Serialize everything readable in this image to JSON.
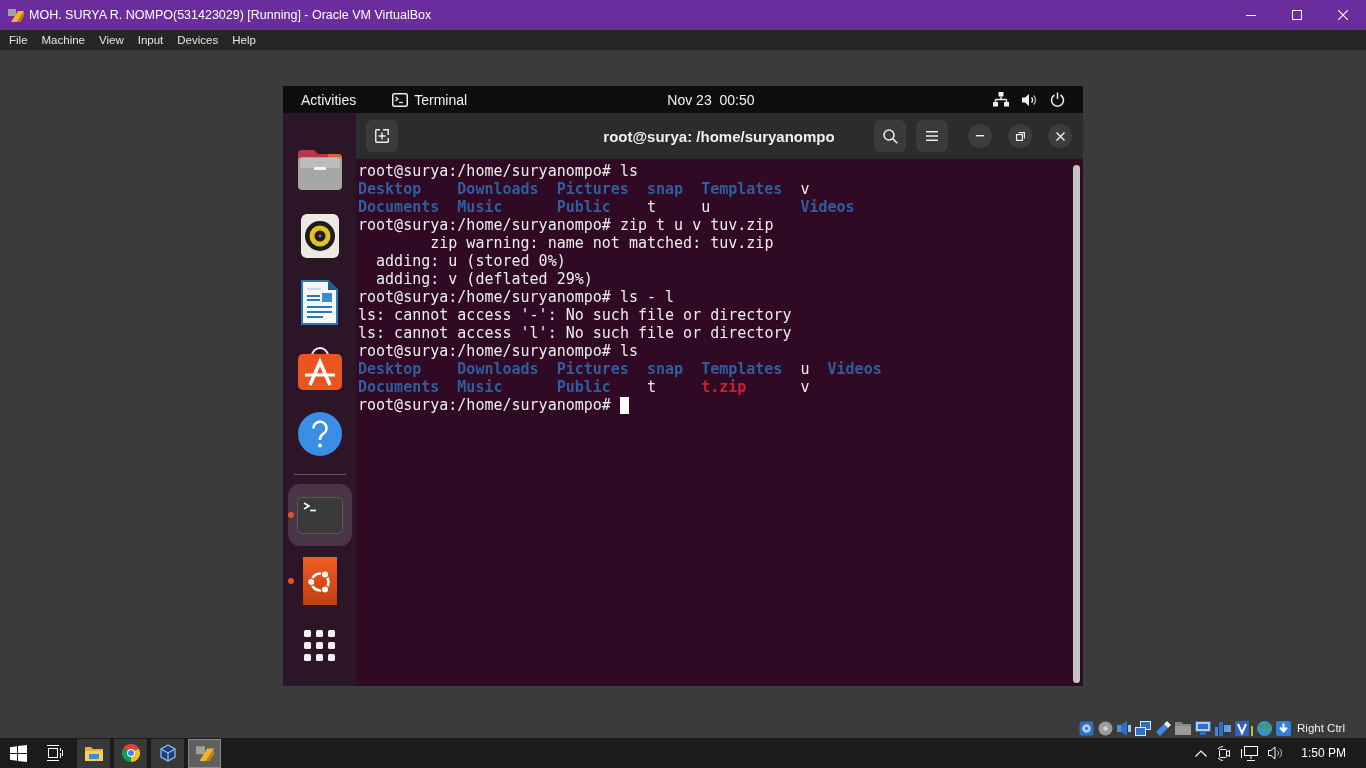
{
  "vbox_window": {
    "title": "MOH. SURYA R. NOMPO(531423029) [Running] - Oracle VM VirtualBox",
    "menu": [
      "File",
      "Machine",
      "View",
      "Input",
      "Devices",
      "Help"
    ]
  },
  "guest": {
    "top_bar": {
      "activities": "Activities",
      "app_menu": "Terminal",
      "clock": "Nov 23  00:50"
    },
    "dock": {
      "favorites": [
        {
          "kind": "folder",
          "running": false,
          "selected": false
        },
        {
          "kind": "speaker",
          "running": false,
          "selected": false
        },
        {
          "kind": "document",
          "running": false,
          "selected": false
        },
        {
          "kind": "bag",
          "running": false,
          "selected": false
        },
        {
          "kind": "help",
          "running": false,
          "selected": false
        }
      ],
      "others": [
        {
          "kind": "terminal",
          "running": true,
          "selected": true
        },
        {
          "kind": "logo",
          "running": true,
          "selected": false
        }
      ]
    },
    "terminal": {
      "title": "root@surya: /home/suryanompo",
      "lines": [
        {
          "kind": "text",
          "text": "root@surya:/home/suryanompo# ls"
        },
        {
          "kind": "listing",
          "columns": [
            [
              {
                "name": "Desktop",
                "kind": "dir"
              },
              {
                "name": "Documents",
                "kind": "dir"
              }
            ],
            [
              {
                "name": "Downloads",
                "kind": "dir"
              },
              {
                "name": "Music",
                "kind": "dir"
              }
            ],
            [
              {
                "name": "Pictures",
                "kind": "dir"
              },
              {
                "name": "Public",
                "kind": "dir"
              }
            ],
            [
              {
                "name": "snap",
                "kind": "dir"
              },
              {
                "name": "t",
                "kind": "file"
              }
            ],
            [
              {
                "name": "Templates",
                "kind": "dir"
              },
              {
                "name": "u",
                "kind": "file"
              }
            ],
            [
              {
                "name": "v",
                "kind": "file"
              },
              {
                "name": "Videos",
                "kind": "dir"
              }
            ]
          ]
        },
        {
          "kind": "text",
          "text": "root@surya:/home/suryanompo# zip t u v tuv.zip"
        },
        {
          "kind": "text",
          "text": "        zip warning: name not matched: tuv.zip"
        },
        {
          "kind": "text",
          "text": "  adding: u (stored 0%)"
        },
        {
          "kind": "text",
          "text": "  adding: v (deflated 29%)"
        },
        {
          "kind": "text",
          "text": "root@surya:/home/suryanompo# ls - l"
        },
        {
          "kind": "text",
          "text": "ls: cannot access '-': No such file or directory"
        },
        {
          "kind": "text",
          "text": "ls: cannot access 'l': No such file or directory"
        },
        {
          "kind": "text",
          "text": "root@surya:/home/suryanompo# ls"
        },
        {
          "kind": "listing",
          "columns": [
            [
              {
                "name": "Desktop",
                "kind": "dir"
              },
              {
                "name": "Documents",
                "kind": "dir"
              }
            ],
            [
              {
                "name": "Downloads",
                "kind": "dir"
              },
              {
                "name": "Music",
                "kind": "dir"
              }
            ],
            [
              {
                "name": "Pictures",
                "kind": "dir"
              },
              {
                "name": "Public",
                "kind": "dir"
              }
            ],
            [
              {
                "name": "snap",
                "kind": "dir"
              },
              {
                "name": "t",
                "kind": "file"
              }
            ],
            [
              {
                "name": "Templates",
                "kind": "dir"
              },
              {
                "name": "t.zip",
                "kind": "archive"
              }
            ],
            [
              {
                "name": "u",
                "kind": "file"
              },
              {
                "name": "v",
                "kind": "file"
              }
            ],
            [
              {
                "name": "Videos",
                "kind": "dir"
              }
            ]
          ]
        },
        {
          "kind": "text",
          "text": "root@surya:/home/suryanompo#",
          "cursor": true
        }
      ]
    }
  },
  "status_bar": {
    "host_key": "Right Ctrl"
  },
  "taskbar": {
    "apps": [
      {
        "kind": "folder",
        "selected": false
      },
      {
        "kind": "browser",
        "selected": false
      },
      {
        "kind": "cube",
        "selected": false
      },
      {
        "kind": "vm",
        "selected": true
      }
    ],
    "clock": "1:50 PM"
  }
}
